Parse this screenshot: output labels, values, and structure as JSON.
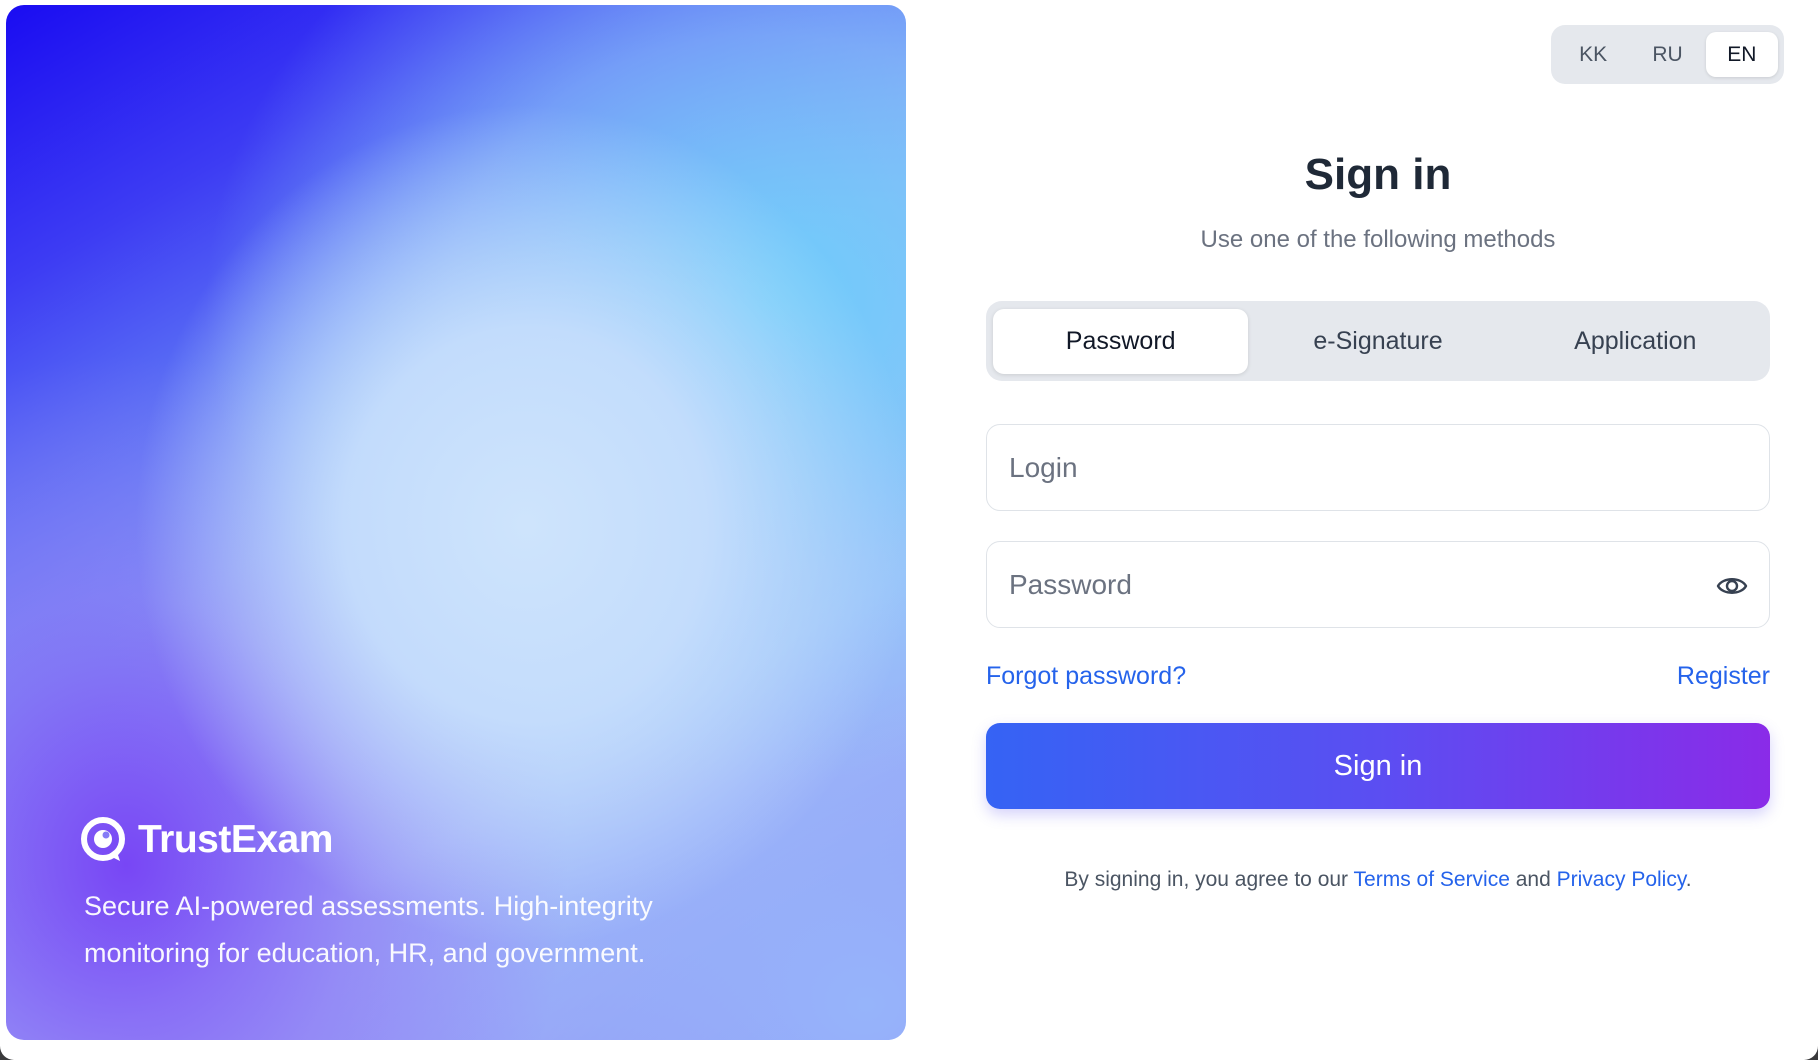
{
  "hero": {
    "brand_name": "TrustExam",
    "tagline": "Secure AI-powered assessments. High-integrity monitoring for education, HR, and government."
  },
  "language": {
    "options": [
      "KK",
      "RU",
      "EN"
    ],
    "selected": "EN"
  },
  "auth": {
    "title": "Sign in",
    "subtitle": "Use one of the following methods",
    "tabs": [
      "Password",
      "e-Signature",
      "Application"
    ],
    "active_tab": "Password",
    "login_placeholder": "Login",
    "password_placeholder": "Password",
    "forgot_label": "Forgot password?",
    "register_label": "Register",
    "submit_label": "Sign in",
    "terms_prefix": "By signing in, you agree to our",
    "terms_link": "Terms of Service",
    "terms_and": "and",
    "privacy_link": "Privacy Policy",
    "terms_suffix": "."
  },
  "colors": {
    "accent": "#2563eb",
    "button_start": "#3563f4",
    "button_end": "#8a2be8"
  },
  "icons": {
    "logo": "trustexam-logo-icon",
    "password_toggle": "eye-icon"
  }
}
